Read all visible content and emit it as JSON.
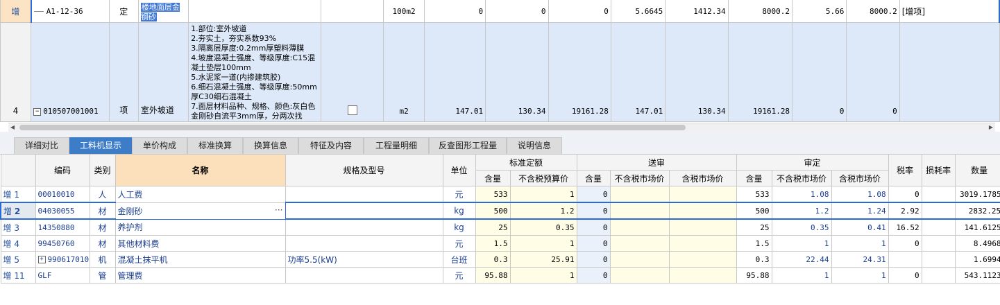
{
  "top_rows": {
    "add_row": {
      "row_label": "增",
      "code": "A1-12-36",
      "type": "定",
      "name": "楼地面层金钢砂",
      "unit": "100m2",
      "v1": "0",
      "v2": "0",
      "v3": "0",
      "v4": "5.6645",
      "v5": "1412.34",
      "v6": "8000.2",
      "v7": "5.66",
      "v8": "8000.2",
      "note": "[增项]"
    },
    "main_row": {
      "row_label": "4",
      "expander": "−",
      "code": "010507001001",
      "type": "项",
      "name": "室外坡道",
      "description": [
        "1.部位:室外坡道",
        "2.夯实土，夯实系数93%",
        "3.隔离层厚度:0.2mm厚塑料薄膜",
        "4.坡度混凝土强度、等级厚度:C15混凝土垫层100mm",
        "5.水泥浆一道(内掺建筑胶)",
        "6.细石混凝土强度、等级厚度:50mm厚C30细石混凝土",
        "7.面层材料品种、规格、颜色:灰白色金刚砂自流平3mm厚，分两次找"
      ],
      "unit": "m2",
      "v1": "147.01",
      "v2": "130.34",
      "v3": "19161.28",
      "v4": "147.01",
      "v5": "130.34",
      "v6": "19161.28",
      "v7": "0",
      "v8": "0"
    }
  },
  "tabs": [
    "详细对比",
    "工料机显示",
    "单价构成",
    "标准换算",
    "换算信息",
    "特征及内容",
    "工程量明细",
    "反查图形工程量",
    "说明信息"
  ],
  "active_tab": "工料机显示",
  "grid": {
    "headers": {
      "code": "编码",
      "category": "类别",
      "name": "名称",
      "spec": "规格及型号",
      "unit": "单位",
      "std_quota": "标准定额",
      "submitted": "送审",
      "approved": "审定",
      "tax_rate": "税率",
      "loss_rate": "损耗率",
      "quantity": "数量",
      "qty": "含量",
      "pretax_budget_price": "不含税预算价",
      "pretax_market_price": "不含税市场价",
      "tax_market_price": "含税市场价"
    },
    "rows": [
      {
        "tag": "增",
        "num": "1",
        "code": "00010010",
        "cat": "人",
        "name": "人工费",
        "spec": "",
        "unit": "元",
        "std_qty": "533",
        "std_price": "1",
        "sub_qty": "0",
        "sub_p1": "",
        "sub_p2": "",
        "app_qty": "533",
        "app_p1": "1.08",
        "app_p2": "1.08",
        "tax": "0",
        "loss": "",
        "quantity": "3019.1785"
      },
      {
        "tag": "增",
        "num": "2",
        "code": "04030055",
        "cat": "材",
        "name": "金刚砂",
        "spec": "",
        "unit": "kg",
        "std_qty": "500",
        "std_price": "1.2",
        "sub_qty": "0",
        "sub_p1": "",
        "sub_p2": "",
        "app_qty": "500",
        "app_p1": "1.2",
        "app_p2": "1.24",
        "tax": "2.92",
        "loss": "",
        "quantity": "2832.25"
      },
      {
        "tag": "增",
        "num": "3",
        "code": "14350880",
        "cat": "材",
        "name": "养护剂",
        "spec": "",
        "unit": "kg",
        "std_qty": "25",
        "std_price": "0.35",
        "sub_qty": "0",
        "sub_p1": "",
        "sub_p2": "",
        "app_qty": "25",
        "app_p1": "0.35",
        "app_p2": "0.41",
        "tax": "16.52",
        "loss": "",
        "quantity": "141.6125"
      },
      {
        "tag": "增",
        "num": "4",
        "code": "99450760",
        "cat": "材",
        "name": "其他材料费",
        "spec": "",
        "unit": "元",
        "std_qty": "1.5",
        "std_price": "1",
        "sub_qty": "0",
        "sub_p1": "",
        "sub_p2": "",
        "app_qty": "1.5",
        "app_p1": "1",
        "app_p2": "1",
        "tax": "0",
        "loss": "",
        "quantity": "8.4968"
      },
      {
        "tag": "增",
        "num": "5",
        "code": "990617010",
        "cat": "机",
        "name": "混凝土抹平机",
        "spec": "功率5.5(kW)",
        "unit": "台班",
        "std_qty": "0.3",
        "std_price": "25.91",
        "sub_qty": "0",
        "sub_p1": "",
        "sub_p2": "",
        "app_qty": "0.3",
        "app_p1": "22.44",
        "app_p2": "24.31",
        "tax": "",
        "loss": "",
        "quantity": "1.6994"
      },
      {
        "tag": "增",
        "num": "11",
        "code": "GLF",
        "cat": "管",
        "name": "管理费",
        "spec": "",
        "unit": "元",
        "std_qty": "95.88",
        "std_price": "1",
        "sub_qty": "0",
        "sub_p1": "",
        "sub_p2": "",
        "app_qty": "95.88",
        "app_p1": "1",
        "app_p2": "1",
        "tax": "0",
        "loss": "",
        "quantity": "543.1123"
      }
    ],
    "dots": "···",
    "expander": "+"
  }
}
